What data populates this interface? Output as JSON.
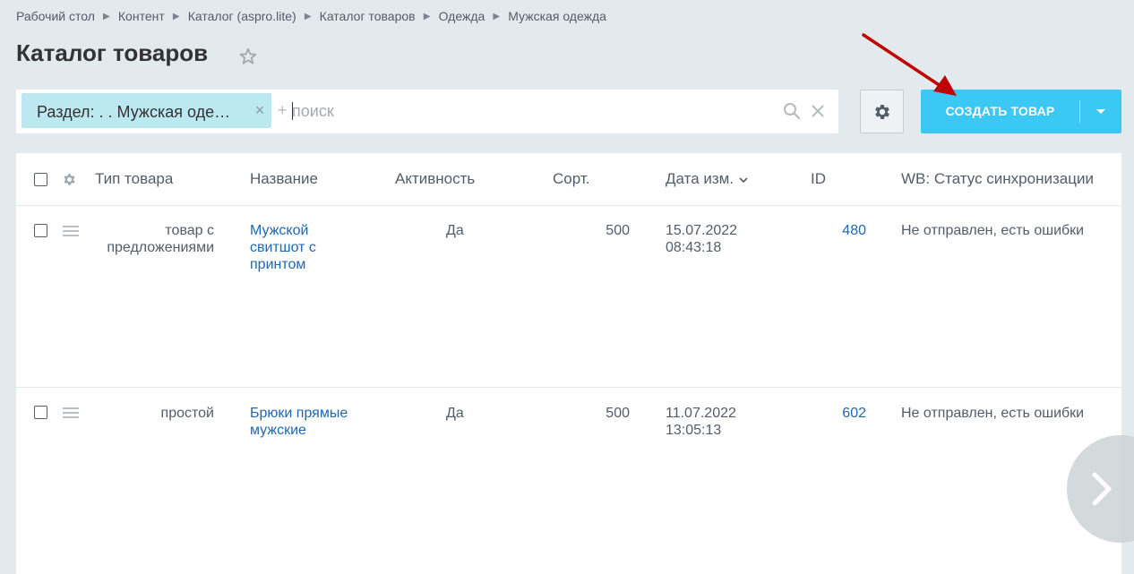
{
  "breadcrumb": [
    "Рабочий стол",
    "Контент",
    "Каталог (aspro.lite)",
    "Каталог товаров",
    "Одежда",
    "Мужская одежда"
  ],
  "page_title": "Каталог товаров",
  "filter": {
    "chip_label": "Раздел: . . Мужская оде…",
    "plus": "+",
    "search_placeholder": "поиск"
  },
  "create_button": {
    "label": "СОЗДАТЬ ТОВАР"
  },
  "colors": {
    "accent": "#3bc8f5",
    "link": "#2067b0",
    "chip": "#bce8f1",
    "annotation_arrow": "#c00000"
  },
  "icons": [
    "star-icon",
    "close-icon",
    "search-icon",
    "gear-icon",
    "chevron-down-icon",
    "drag-handle-icon",
    "chevron-right-icon",
    "arrow-annotation"
  ],
  "grid": {
    "columns": [
      "Тип товара",
      "Название",
      "Активность",
      "Сорт.",
      "Дата изм.",
      "ID",
      "WB: Статус синхронизации"
    ],
    "rows": [
      {
        "type_lines": [
          "товар с",
          "предложениями"
        ],
        "name_lines": [
          "Мужской",
          "свитшот с",
          "принтом"
        ],
        "active": "Да",
        "sort": "500",
        "date": "15.07.2022",
        "time": "08:43:18",
        "id": "480",
        "wb_status": "Не отправлен, есть ошибки"
      },
      {
        "type_lines": [
          "простой"
        ],
        "name_lines": [
          "Брюки прямые",
          "мужские"
        ],
        "active": "Да",
        "sort": "500",
        "date": "11.07.2022",
        "time": "13:05:13",
        "id": "602",
        "wb_status": "Не отправлен, есть ошибки"
      }
    ]
  }
}
